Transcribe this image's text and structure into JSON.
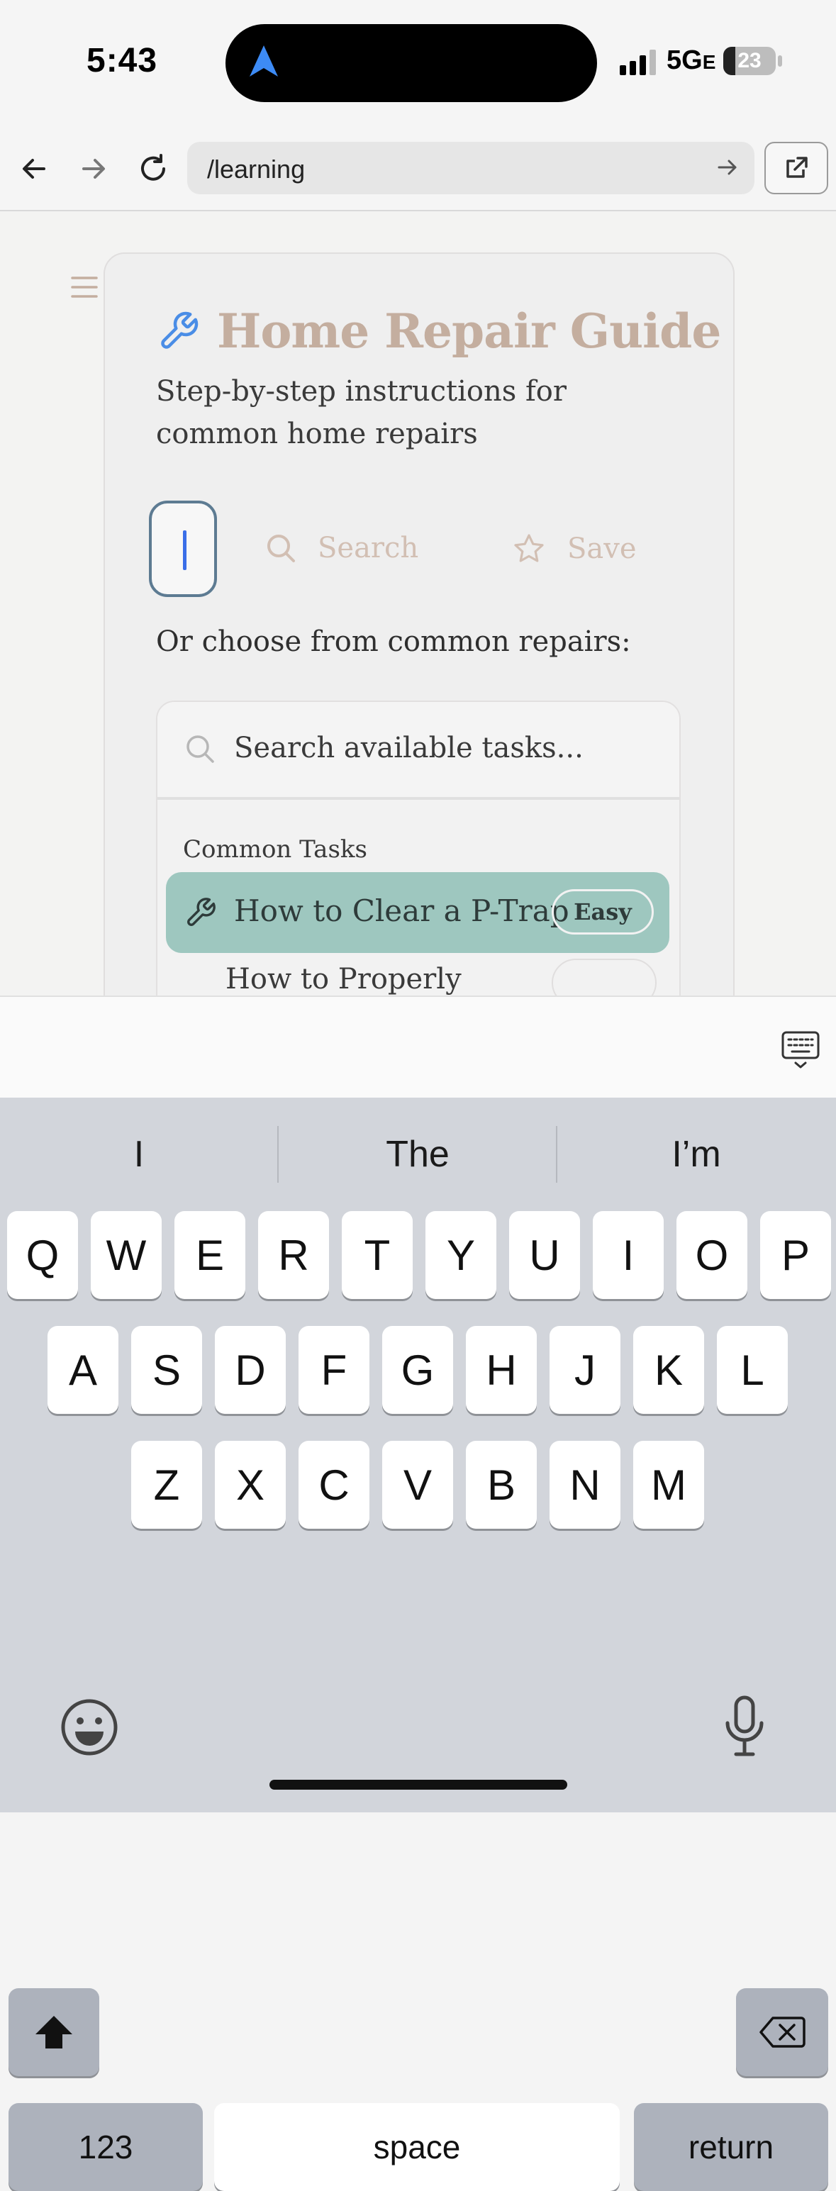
{
  "status_bar": {
    "time": "5:43",
    "network": "5G",
    "network_suffix": "E",
    "battery": "23",
    "battery_level": 0.23
  },
  "browser": {
    "url": "/learning"
  },
  "app": {
    "title": "Home Repair Guide",
    "subtitle": "Step-by-step instructions for common home repairs",
    "search_label": "Search",
    "save_label": "Save",
    "choose_label": "Or choose from common repairs:",
    "task_search_placeholder": "Search available tasks...",
    "group_heading": "Common Tasks",
    "tasks": [
      {
        "label": "How to Clear a P-Trap",
        "difficulty": "Easy"
      },
      {
        "label": "How to Properly",
        "difficulty": ""
      }
    ]
  },
  "keyboard": {
    "suggestions": [
      "I",
      "The",
      "I’m"
    ],
    "row1": [
      "Q",
      "W",
      "E",
      "R",
      "T",
      "Y",
      "U",
      "I",
      "O",
      "P"
    ],
    "row2": [
      "A",
      "S",
      "D",
      "F",
      "G",
      "H",
      "J",
      "K",
      "L"
    ],
    "row3": [
      "Z",
      "X",
      "C",
      "V",
      "B",
      "N",
      "M"
    ],
    "numbers_label": "123",
    "space_label": "space",
    "return_label": "return"
  },
  "colors": {
    "accent_title": "#c4ae9f",
    "selected_task": "#9ec7bf",
    "caret": "#3a6ee8"
  }
}
